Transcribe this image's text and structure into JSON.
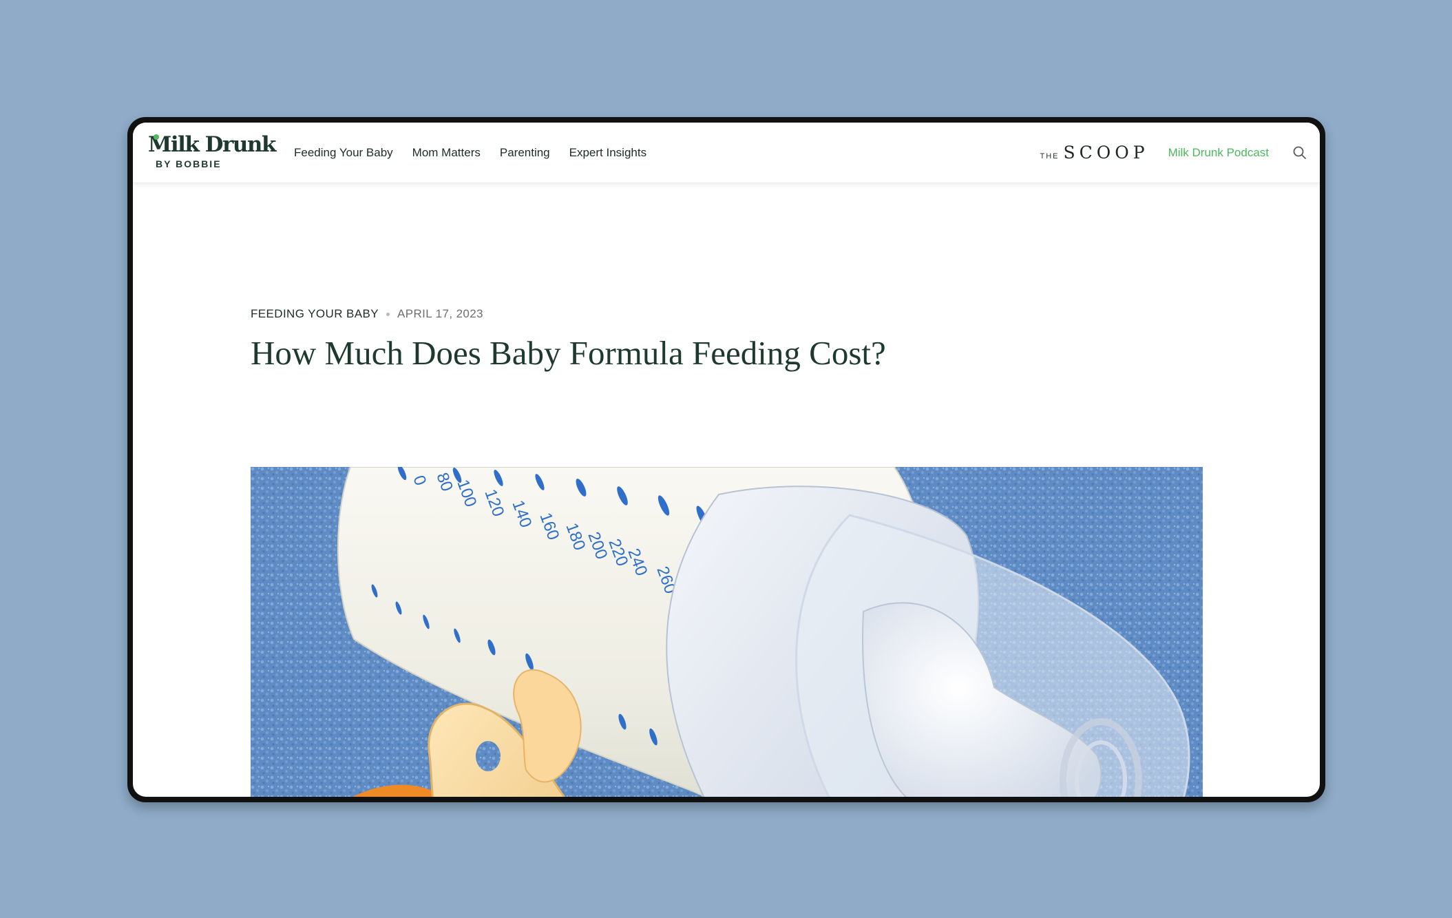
{
  "brand": {
    "name": "Milk Drunk",
    "byline": "BY BOBBIE"
  },
  "nav": {
    "items": [
      "Feeding Your Baby",
      "Mom Matters",
      "Parenting",
      "Expert Insights"
    ]
  },
  "header_right": {
    "scoop_prefix": "THE",
    "scoop_word": "SCOOP",
    "podcast_label": "Milk Drunk Podcast",
    "search_icon": "search-icon"
  },
  "article": {
    "category": "FEEDING YOUR BABY",
    "date": "APRIL 17, 2023",
    "title": "How Much Does Baby Formula Feeding Cost?",
    "hero_markings": [
      "0",
      "80",
      "100",
      "120",
      "140",
      "160",
      "180",
      "200",
      "220",
      "240",
      "260"
    ]
  },
  "colors": {
    "page_background": "#8fabc8",
    "brand_green": "#1e3a2e",
    "accent_green": "#4cb85c",
    "towel_blue": "#5f8bc4",
    "pacifier_orange": "#f08a24"
  }
}
